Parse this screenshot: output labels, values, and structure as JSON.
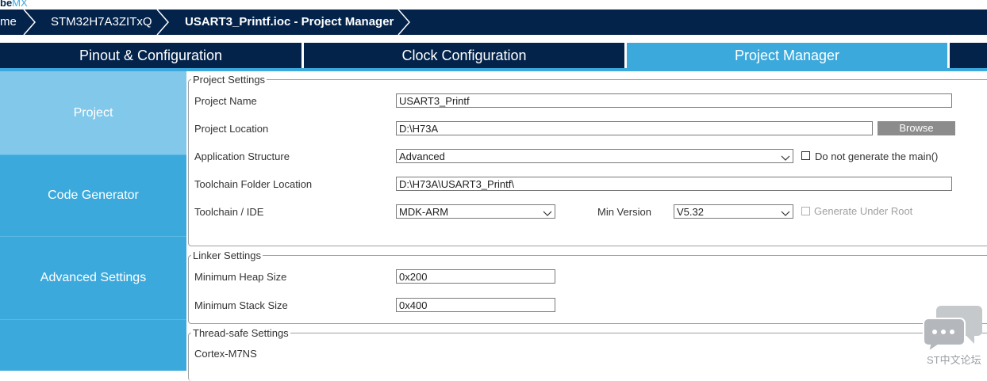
{
  "logo": {
    "text_a": "be",
    "text_b": "MX"
  },
  "breadcrumb": {
    "home": "me",
    "mcu": "STM32H7A3ZITxQ",
    "project": "USART3_Printf.ioc - Project Manager"
  },
  "tabs": [
    {
      "label": "Pinout & Configuration",
      "active": false
    },
    {
      "label": "Clock Configuration",
      "active": false
    },
    {
      "label": "Project Manager",
      "active": true
    }
  ],
  "sidebar": {
    "items": [
      {
        "label": "Project",
        "active": true
      },
      {
        "label": "Code Generator",
        "active": false
      },
      {
        "label": "Advanced Settings",
        "active": false
      }
    ]
  },
  "project_settings": {
    "title": "Project Settings",
    "name_label": "Project Name",
    "name_value": "USART3_Printf",
    "location_label": "Project Location",
    "location_value": "D:\\H73A",
    "browse_label": "Browse",
    "structure_label": "Application Structure",
    "structure_value": "Advanced",
    "no_main_label": "Do not generate the main()",
    "toolchain_folder_label": "Toolchain Folder Location",
    "toolchain_folder_value": "D:\\H73A\\USART3_Printf\\",
    "toolchain_label": "Toolchain / IDE",
    "toolchain_value": "MDK-ARM",
    "min_version_label": "Min Version",
    "min_version_value": "V5.32",
    "gen_under_root_label": "Generate Under Root"
  },
  "linker_settings": {
    "title": "Linker Settings",
    "heap_label": "Minimum Heap Size",
    "heap_value": "0x200",
    "stack_label": "Minimum Stack Size",
    "stack_value": "0x400"
  },
  "thread_safe": {
    "title": "Thread-safe Settings",
    "core_label": "Cortex-M7NS"
  },
  "watermark": {
    "text": "ST中文论坛"
  },
  "colors": {
    "navy": "#03234b",
    "accent": "#3ca9dc",
    "active_nav": "#82c8ea"
  }
}
